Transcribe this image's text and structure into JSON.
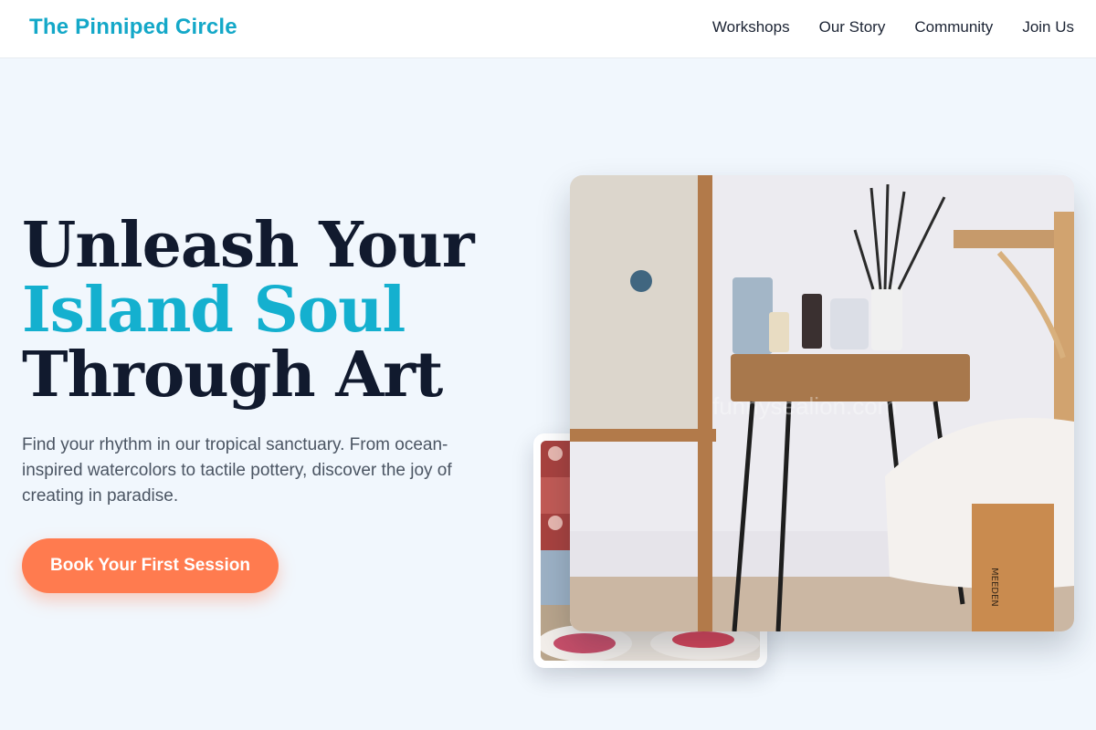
{
  "brand": {
    "name": "The Pinniped Circle",
    "accent_color": "#14a8c8"
  },
  "nav": {
    "items": [
      {
        "label": "Workshops"
      },
      {
        "label": "Our Story"
      },
      {
        "label": "Community"
      },
      {
        "label": "Join Us"
      }
    ]
  },
  "hero": {
    "title_line1": "Unleash Your",
    "title_line2": "Island Soul",
    "title_line3": "Through Art",
    "description": "Find your rhythm in our tropical sanctuary. From ocean-inspired watercolors to tactile pottery, discover the joy of creating in paradise.",
    "cta_label": "Book Your First Session",
    "cta_color": "#ff7b4f",
    "title_accent_color": "#14b0cf"
  },
  "images": {
    "main": {
      "watermark": "funnysealion.com",
      "stool_text": "MEEDEN"
    },
    "secondary": {}
  }
}
